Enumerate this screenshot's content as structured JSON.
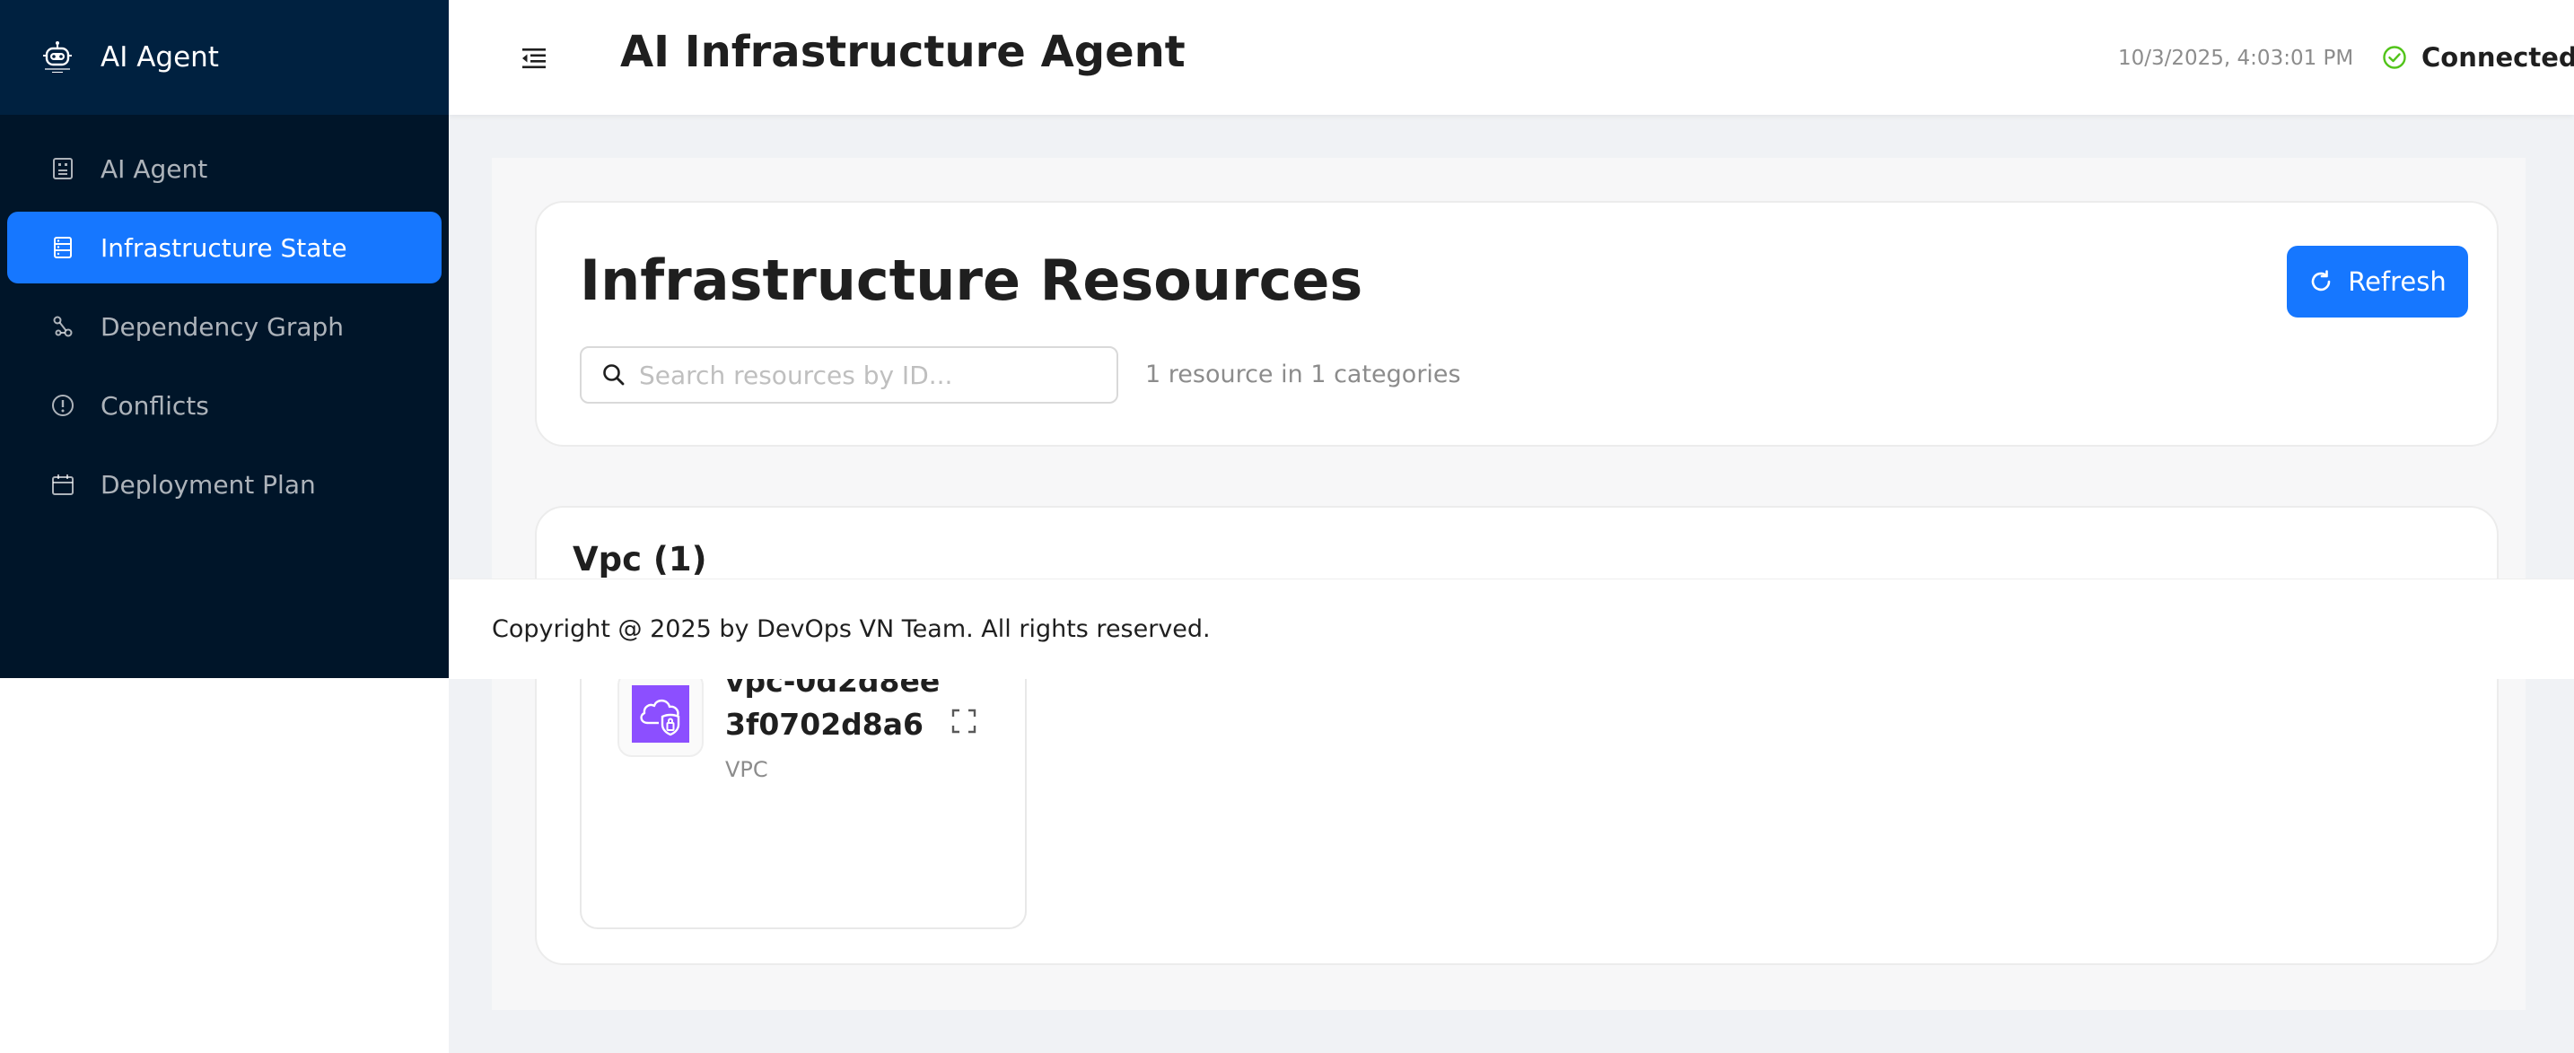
{
  "sidebar": {
    "app_name": "AI Agent",
    "items": [
      {
        "label": "AI Agent",
        "icon": "robot-icon",
        "active": false
      },
      {
        "label": "Infrastructure State",
        "icon": "database-icon",
        "active": true
      },
      {
        "label": "Dependency Graph",
        "icon": "graph-icon",
        "active": false
      },
      {
        "label": "Conflicts",
        "icon": "exclamation-circle-icon",
        "active": false
      },
      {
        "label": "Deployment Plan",
        "icon": "calendar-icon",
        "active": false
      }
    ]
  },
  "header": {
    "title": "AI Infrastructure Agent",
    "timestamp": "10/3/2025, 4:03:01 PM",
    "status": "Connected",
    "status_color": "#52c41a"
  },
  "main": {
    "page_title": "Infrastructure Resources",
    "refresh_label": "Refresh",
    "search_placeholder": "Search resources by ID...",
    "search_value": "",
    "summary": "1 resource in 1 categories",
    "categories": [
      {
        "title": "Vpc (1)",
        "resources": [
          {
            "name": "vpc-0d2d8ee3f0702d8a6",
            "type": "VPC",
            "icon": "vpc-cloud-icon",
            "icon_color": "#8c4fff"
          }
        ]
      }
    ]
  },
  "footer": {
    "text": "Copyright @ 2025 by DevOps VN Team. All rights reserved."
  },
  "colors": {
    "sidebar_bg": "#001529",
    "accent": "#1677ff"
  }
}
